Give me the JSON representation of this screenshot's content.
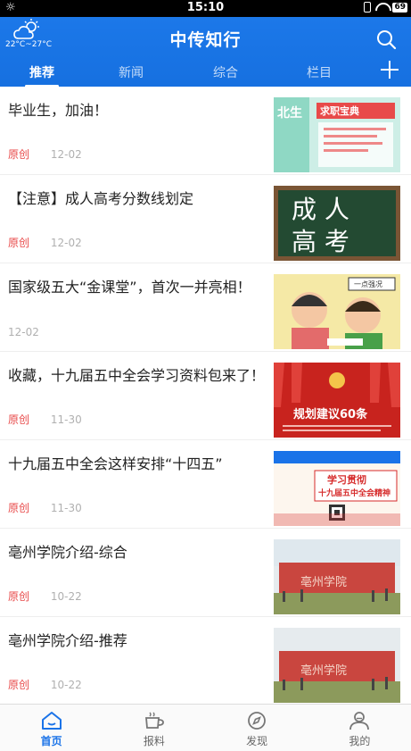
{
  "status_bar": {
    "time": "15:10",
    "battery": "69"
  },
  "header": {
    "temperature": "22°C~27°C",
    "title": "中传知行"
  },
  "tabs": [
    "推荐",
    "新闻",
    "综合",
    "栏目"
  ],
  "news": [
    {
      "title": "毕业生，加油！",
      "tag": "原创",
      "date": "12-02",
      "thumb_text": "求职宝典"
    },
    {
      "title": "【注意】成人高考分数线划定",
      "tag": "原创",
      "date": "12-02",
      "thumb_text": "成人高考"
    },
    {
      "title": "国家级五大“金课堂”，首次一并亮相！",
      "tag": "",
      "date": "12-02",
      "thumb_text": "一点强况"
    },
    {
      "title": "收藏，十九届五中全会学习资料包来了！",
      "tag": "原创",
      "date": "11-30",
      "thumb_text": "规划建议60条"
    },
    {
      "title": "十九届五中全会这样安排“十四五”",
      "tag": "原创",
      "date": "11-30",
      "thumb_text": "学习贯彻 十九届五中全会精神"
    },
    {
      "title": "亳州学院介绍-综合",
      "tag": "原创",
      "date": "10-22",
      "thumb_text": "亳州学院"
    },
    {
      "title": "亳州学院介绍-推荐",
      "tag": "原创",
      "date": "10-22",
      "thumb_text": "亳州学院"
    }
  ],
  "bottom_nav": [
    {
      "label": "首页",
      "icon": "home-icon"
    },
    {
      "label": "报料",
      "icon": "coffee-icon"
    },
    {
      "label": "发现",
      "icon": "compass-icon"
    },
    {
      "label": "我的",
      "icon": "person-icon"
    }
  ],
  "colors": {
    "primary": "#1a73e8",
    "tag": "#e84a4a"
  }
}
